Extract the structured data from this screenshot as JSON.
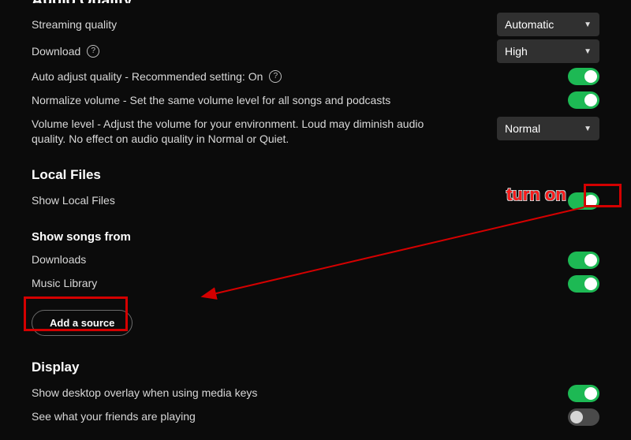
{
  "audioQuality": {
    "title": "Audio Quality",
    "streaming": {
      "label": "Streaming quality",
      "value": "Automatic"
    },
    "download": {
      "label": "Download",
      "value": "High"
    },
    "autoAdjust": {
      "label": "Auto adjust quality - Recommended setting: On",
      "on": true
    },
    "normalize": {
      "label": "Normalize volume - Set the same volume level for all songs and podcasts",
      "on": true
    },
    "volumeLevel": {
      "label": "Volume level - Adjust the volume for your environment. Loud may diminish audio quality. No effect on audio quality in Normal or Quiet.",
      "value": "Normal"
    }
  },
  "localFiles": {
    "title": "Local Files",
    "show": {
      "label": "Show Local Files",
      "on": true
    },
    "songsFromTitle": "Show songs from",
    "downloads": {
      "label": "Downloads",
      "on": true
    },
    "musicLibrary": {
      "label": "Music Library",
      "on": true
    },
    "addSource": "Add a source"
  },
  "display": {
    "title": "Display",
    "overlay": {
      "label": "Show desktop overlay when using media keys",
      "on": true
    },
    "friends": {
      "label": "See what your friends are playing",
      "on": false
    }
  },
  "annotations": {
    "turnOn": "turn on"
  },
  "colors": {
    "accent": "#1db954",
    "annotation": "#d40000"
  }
}
